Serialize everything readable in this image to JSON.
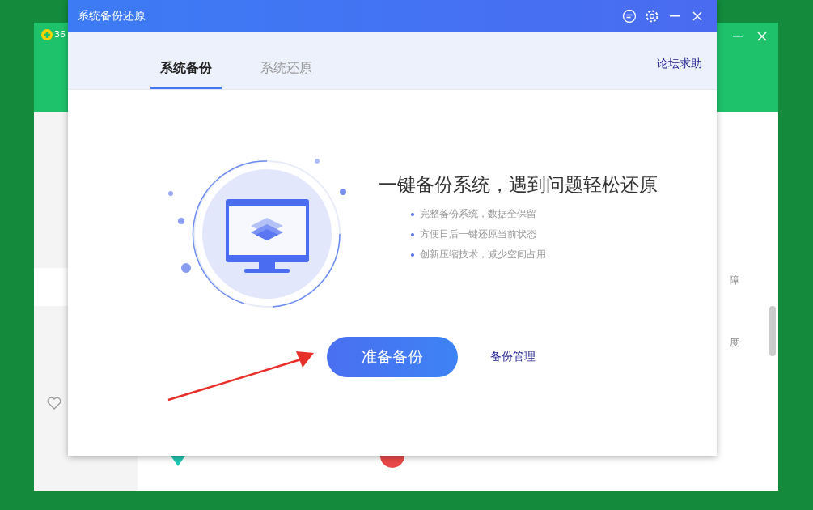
{
  "background_window": {
    "title": "36",
    "side_fragments": [
      "障",
      "度"
    ]
  },
  "dialog": {
    "title": "系统备份还原",
    "tabs": [
      {
        "label": "系统备份",
        "selected": true
      },
      {
        "label": "系统还原",
        "selected": false
      }
    ],
    "help_link": "论坛求助",
    "headline": "一键备份系统，遇到问题轻松还原",
    "features": [
      "完整备份系统，数据全保留",
      "方便日后一键还原当前状态",
      "创新压缩技术，减少空间占用"
    ],
    "primary_button": "准备备份",
    "manage_link": "备份管理"
  }
}
